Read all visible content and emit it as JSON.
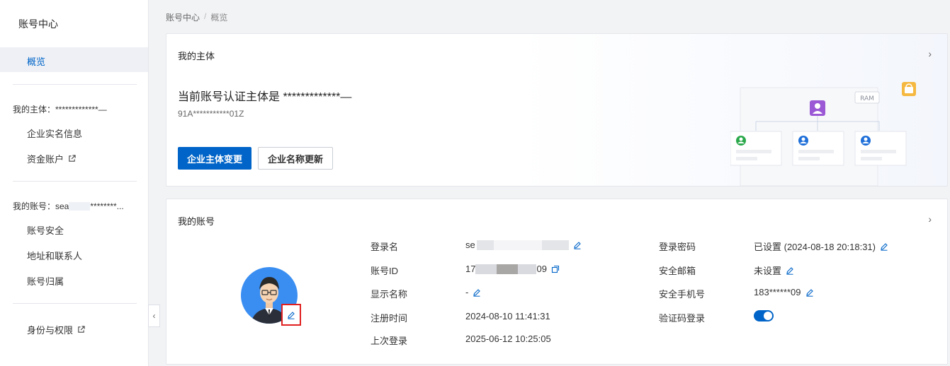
{
  "sidebar": {
    "title": "账号中心",
    "overview": "概览",
    "entity_group": "我的主体：*************—",
    "entity_items": [
      "企业实名信息",
      "资金账户"
    ],
    "account_group": "我的账号：sea",
    "account_group_suffix": "********...",
    "account_items": [
      "账号安全",
      "地址和联系人",
      "账号归属"
    ],
    "identity_item": "身份与权限"
  },
  "breadcrumb": {
    "root": "账号中心",
    "sep": "/",
    "current": "概览"
  },
  "entity_card": {
    "title": "我的主体",
    "statement": "当前账号认证主体是 *************—",
    "code": "91A***********01Z",
    "primary_button": "企业主体变更",
    "secondary_button": "企业名称更新",
    "ram_label": "RAM"
  },
  "account_card": {
    "title": "我的账号",
    "left_fields": {
      "login_name_label": "登录名",
      "login_name_value": "se",
      "account_id_label": "账号ID",
      "account_id_prefix": "17",
      "account_id_suffix": "09",
      "display_name_label": "显示名称",
      "display_name_value": "-",
      "register_time_label": "注册时间",
      "register_time_value": "2024-08-10 11:41:31",
      "last_login_label": "上次登录",
      "last_login_value": "2025-06-12 10:25:05"
    },
    "right_fields": {
      "password_label": "登录密码",
      "password_value": "已设置 (2024-08-18 20:18:31)",
      "email_label": "安全邮箱",
      "email_value": "未设置",
      "phone_label": "安全手机号",
      "phone_value": "183******09",
      "code_login_label": "验证码登录",
      "code_login_enabled": true
    }
  },
  "colors": {
    "primary": "#0064c8",
    "highlight_border": "#e02020",
    "avatar_bg": "#3a8ef2"
  }
}
